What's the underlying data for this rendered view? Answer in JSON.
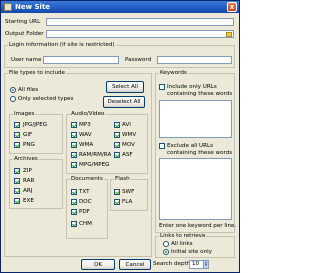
{
  "window": {
    "title": "New Site",
    "close_glyph": "x",
    "icon": "app-icon"
  },
  "form": {
    "starting_url_label": "Starting URL",
    "starting_url_value": "",
    "output_folder_label": "Output Folder",
    "output_folder_value": "",
    "browse_icon": "folder-icon"
  },
  "login": {
    "legend": "Login information (if site is restricted)",
    "user_label": "User name",
    "user_value": "",
    "password_label": "Password",
    "password_value": ""
  },
  "filetypes": {
    "legend": "File types to include",
    "all_files": {
      "label": "All files",
      "selected": true
    },
    "only_selected": {
      "label": "Only selected types",
      "selected": false
    },
    "select_all": "Select All",
    "deselect_all": "Deselect All",
    "images": {
      "legend": "Images",
      "items": [
        {
          "label": "JPG/JPEG",
          "checked": true
        },
        {
          "label": "GIF",
          "checked": true
        },
        {
          "label": "PNG",
          "checked": true
        }
      ]
    },
    "audio_video": {
      "legend": "Audio/Video",
      "items": [
        {
          "label": "MP3",
          "checked": true
        },
        {
          "label": "WAV",
          "checked": true
        },
        {
          "label": "WMA",
          "checked": true
        },
        {
          "label": "RAM/RM/RA",
          "checked": true
        },
        {
          "label": "MPG/MPEG",
          "checked": true
        },
        {
          "label": "AVI",
          "checked": true
        },
        {
          "label": "WMV",
          "checked": true
        },
        {
          "label": "MOV",
          "checked": true
        },
        {
          "label": "ASF",
          "checked": true
        }
      ]
    },
    "archives": {
      "legend": "Archives",
      "items": [
        {
          "label": "ZIP",
          "checked": true
        },
        {
          "label": "RAR",
          "checked": true
        },
        {
          "label": "ARJ",
          "checked": true
        },
        {
          "label": "EXE",
          "checked": true
        }
      ]
    },
    "documents": {
      "legend": "Documents",
      "items": [
        {
          "label": "TXT",
          "checked": true
        },
        {
          "label": "DOC",
          "checked": true
        },
        {
          "label": "PDF",
          "checked": true
        },
        {
          "label": "CHM",
          "checked": true
        }
      ]
    },
    "flash": {
      "legend": "Flash",
      "items": [
        {
          "label": "SWF",
          "checked": true
        },
        {
          "label": "FLA",
          "checked": true
        }
      ]
    }
  },
  "keywords": {
    "legend": "Keywords",
    "include_label_1": "Include only URLs",
    "include_label_2": "containing these words",
    "include_checked": false,
    "exclude_label_1": "Exclude all URLs",
    "exclude_label_2": "containing these words",
    "exclude_checked": false,
    "hint": "Enter one keyword per line."
  },
  "links": {
    "legend": "Links to retrieve",
    "all_links": {
      "label": "All links",
      "selected": false
    },
    "initial_only": {
      "label": "Initial site only",
      "selected": true
    }
  },
  "search_depth": {
    "label": "Search depth",
    "value": "10"
  },
  "buttons": {
    "ok": "OK",
    "cancel": "Cancel"
  }
}
